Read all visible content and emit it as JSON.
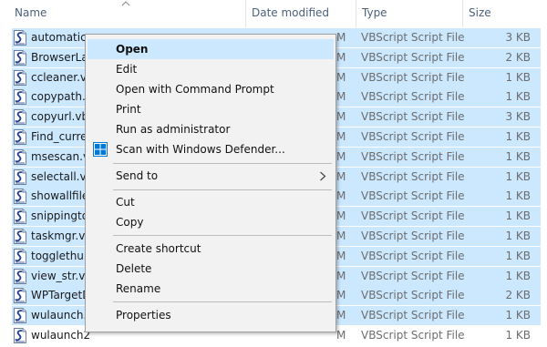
{
  "columns": {
    "name": "Name",
    "date_modified": "Date modified",
    "type": "Type",
    "size": "Size"
  },
  "files": [
    {
      "name": "automatic_",
      "date_fragment": "M",
      "type": "VBScript Script File",
      "size": "3 KB",
      "selected": true
    },
    {
      "name": "BrowserLau",
      "date_fragment": "M",
      "type": "VBScript Script File",
      "size": "2 KB",
      "selected": true
    },
    {
      "name": "ccleaner.vb",
      "date_fragment": "M",
      "type": "VBScript Script File",
      "size": "1 KB",
      "selected": true
    },
    {
      "name": "copypath.v",
      "date_fragment": "M",
      "type": "VBScript Script File",
      "size": "1 KB",
      "selected": true
    },
    {
      "name": "copyurl.vb",
      "date_fragment": "M",
      "type": "VBScript Script File",
      "size": "3 KB",
      "selected": true
    },
    {
      "name": "Find_curre",
      "date_fragment": "M",
      "type": "VBScript Script File",
      "size": "1 KB",
      "selected": true
    },
    {
      "name": "msescan.vl",
      "date_fragment": "M",
      "type": "VBScript Script File",
      "size": "1 KB",
      "selected": true
    },
    {
      "name": "selectall.vb",
      "date_fragment": "M",
      "type": "VBScript Script File",
      "size": "1 KB",
      "selected": true
    },
    {
      "name": "showallfile",
      "date_fragment": "M",
      "type": "VBScript Script File",
      "size": "1 KB",
      "selected": true
    },
    {
      "name": "snippingto",
      "date_fragment": "M",
      "type": "VBScript Script File",
      "size": "1 KB",
      "selected": true
    },
    {
      "name": "taskmgr.vb",
      "date_fragment": "M",
      "type": "VBScript Script File",
      "size": "1 KB",
      "selected": true
    },
    {
      "name": "togglethun",
      "date_fragment": "M",
      "type": "VBScript Script File",
      "size": "1 KB",
      "selected": true
    },
    {
      "name": "view_str.vb",
      "date_fragment": "M",
      "type": "VBScript Script File",
      "size": "1 KB",
      "selected": true
    },
    {
      "name": "WPTargetD",
      "date_fragment": "M",
      "type": "VBScript Script File",
      "size": "2 KB",
      "selected": true
    },
    {
      "name": "wulaunch.",
      "date_fragment": "M",
      "type": "VBScript Script File",
      "size": "1 KB",
      "selected": true
    },
    {
      "name": "wulaunch2",
      "date_fragment": "M",
      "type": "VBScript Script File",
      "size": "1 KB",
      "selected": false
    }
  ],
  "context_menu": {
    "open": "Open",
    "edit": "Edit",
    "open_cmd": "Open with Command Prompt",
    "print": "Print",
    "run_admin": "Run as administrator",
    "scan_defender": "Scan with Windows Defender...",
    "send_to": "Send to",
    "cut": "Cut",
    "copy": "Copy",
    "create_shortcut": "Create shortcut",
    "delete": "Delete",
    "rename": "Rename",
    "properties": "Properties"
  },
  "colors": {
    "selection": "#cce8ff",
    "menu_background": "#f2f2f2",
    "header_text": "#4c607a",
    "defender_blue": "#0078d7"
  },
  "icons": {
    "file": "vbscript-file-icon",
    "defender": "windows-defender-icon",
    "submenu": "chevron-right-icon",
    "sort": "sort-ascending-icon"
  }
}
